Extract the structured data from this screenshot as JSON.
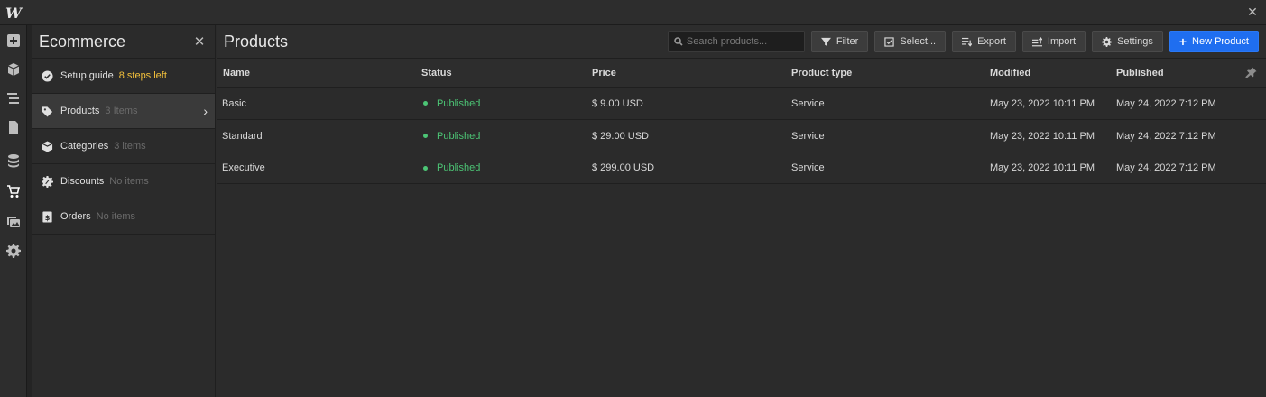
{
  "app": {
    "logo": "W"
  },
  "rail": {
    "icons": [
      "add-panel-icon",
      "box-icon",
      "navigator-icon",
      "pages-icon",
      "cms-icon",
      "cart-icon",
      "assets-icon",
      "settings-icon"
    ]
  },
  "panel": {
    "title": "Ecommerce",
    "items": [
      {
        "label": "Setup guide",
        "meta": "8 steps left",
        "icon": "check-circle-icon"
      },
      {
        "label": "Products",
        "meta": "3 Items",
        "icon": "tag-icon"
      },
      {
        "label": "Categories",
        "meta": "3 items",
        "icon": "category-icon"
      },
      {
        "label": "Discounts",
        "meta": "No items",
        "icon": "discount-icon"
      },
      {
        "label": "Orders",
        "meta": "No items",
        "icon": "orders-icon"
      }
    ]
  },
  "main": {
    "title": "Products",
    "search_placeholder": "Search products...",
    "buttons": {
      "filter": "Filter",
      "select": "Select...",
      "export": "Export",
      "import": "Import",
      "settings": "Settings",
      "new_product": "New Product"
    },
    "columns": [
      "Name",
      "Status",
      "Price",
      "Product type",
      "Modified",
      "Published"
    ],
    "rows": [
      {
        "name": "Basic",
        "status": "Published",
        "price": "$ 9.00 USD",
        "type": "Service",
        "modified": "May 23, 2022 10:11 PM",
        "published": "May 24, 2022 7:12 PM"
      },
      {
        "name": "Standard",
        "status": "Published",
        "price": "$ 29.00 USD",
        "type": "Service",
        "modified": "May 23, 2022 10:11 PM",
        "published": "May 24, 2022 7:12 PM"
      },
      {
        "name": "Executive",
        "status": "Published",
        "price": "$ 299.00 USD",
        "type": "Service",
        "modified": "May 23, 2022 10:11 PM",
        "published": "May 24, 2022 7:12 PM"
      }
    ]
  },
  "colors": {
    "accent": "#1f6ef0",
    "status_published": "#4cc575",
    "warn": "#f3c03b"
  }
}
